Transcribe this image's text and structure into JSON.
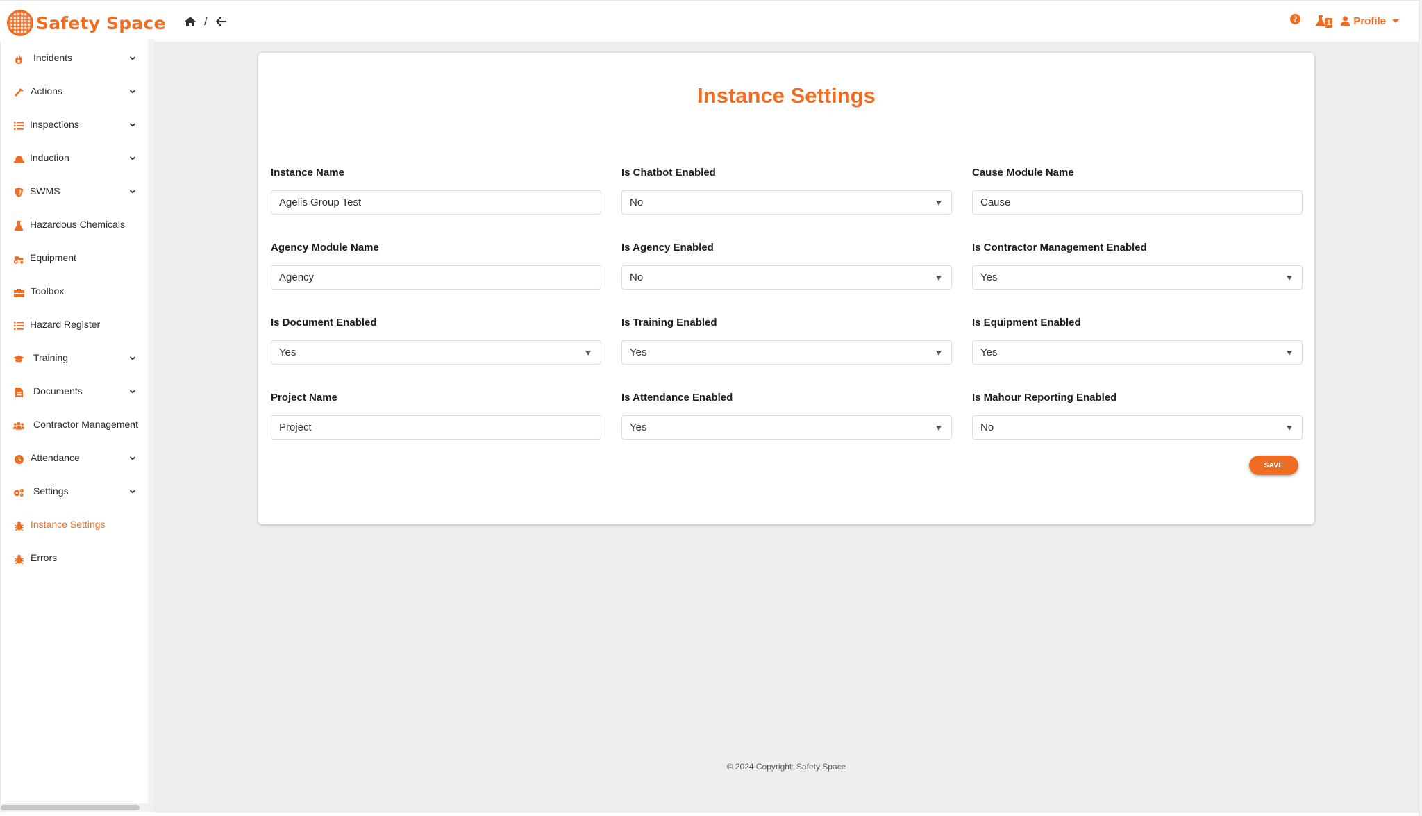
{
  "app": {
    "logo_text": "Safety Space",
    "accent_color": "#ef6c23"
  },
  "topbar": {
    "breadcrumb_separator": "/",
    "notification_count": "1",
    "profile_label": "Profile"
  },
  "sidebar": {
    "items": [
      {
        "label": "Incidents",
        "icon": "fire-icon",
        "has_chevron": true
      },
      {
        "label": "Actions",
        "icon": "hammer-icon",
        "has_chevron": true
      },
      {
        "label": "Inspections",
        "icon": "list-icon",
        "has_chevron": true
      },
      {
        "label": "Induction",
        "icon": "hard-hat-icon",
        "has_chevron": true
      },
      {
        "label": "SWMS",
        "icon": "shield-icon",
        "has_chevron": true
      },
      {
        "label": "Hazardous Chemicals",
        "icon": "flask-icon",
        "has_chevron": false
      },
      {
        "label": "Equipment",
        "icon": "tractor-icon",
        "has_chevron": false
      },
      {
        "label": "Toolbox",
        "icon": "toolbox-icon",
        "has_chevron": false
      },
      {
        "label": "Hazard Register",
        "icon": "list-icon",
        "has_chevron": false
      },
      {
        "label": "Training",
        "icon": "graduation-cap-icon",
        "has_chevron": true
      },
      {
        "label": "Documents",
        "icon": "file-icon",
        "has_chevron": true
      },
      {
        "label": "Contractor Management",
        "icon": "users-icon",
        "has_chevron": true
      },
      {
        "label": "Attendance",
        "icon": "clock-icon",
        "has_chevron": true
      },
      {
        "label": "Settings",
        "icon": "cogs-icon",
        "has_chevron": true
      },
      {
        "label": "Instance Settings",
        "icon": "bug-icon",
        "has_chevron": false,
        "active": true
      },
      {
        "label": "Errors",
        "icon": "bug-icon",
        "has_chevron": false
      }
    ]
  },
  "page": {
    "title": "Instance Settings",
    "save_label": "SAVE",
    "footer": "© 2024 Copyright: Safety Space"
  },
  "fields": [
    {
      "label": "Instance Name",
      "type": "input",
      "value": "Agelis Group Test"
    },
    {
      "label": "Is Chatbot Enabled",
      "type": "select",
      "value": "No"
    },
    {
      "label": "Cause Module Name",
      "type": "input",
      "value": "Cause"
    },
    {
      "label": "Agency Module Name",
      "type": "input",
      "value": "Agency"
    },
    {
      "label": "Is Agency Enabled",
      "type": "select",
      "value": "No"
    },
    {
      "label": "Is Contractor Management Enabled",
      "type": "select",
      "value": "Yes"
    },
    {
      "label": "Is Document Enabled",
      "type": "select",
      "value": "Yes"
    },
    {
      "label": "Is Training Enabled",
      "type": "select",
      "value": "Yes"
    },
    {
      "label": "Is Equipment Enabled",
      "type": "select",
      "value": "Yes"
    },
    {
      "label": "Project Name",
      "type": "input",
      "value": "Project"
    },
    {
      "label": "Is Attendance Enabled",
      "type": "select",
      "value": "Yes"
    },
    {
      "label": "Is Mahour Reporting Enabled",
      "type": "select",
      "value": "No"
    }
  ]
}
